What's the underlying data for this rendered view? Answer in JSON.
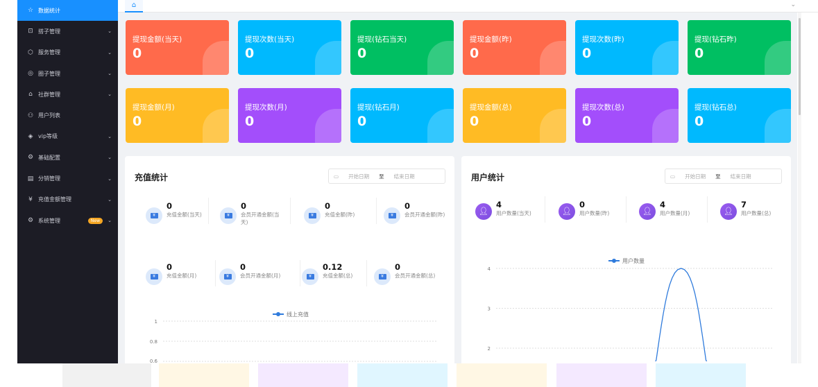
{
  "sidebar": {
    "items": [
      {
        "label": "数据统计",
        "icon": "star-icon",
        "glyph": "☆",
        "active": true
      },
      {
        "label": "搭子管理",
        "icon": "partner-icon",
        "glyph": "⊡",
        "chevron": true
      },
      {
        "label": "服务管理",
        "icon": "cube-icon",
        "glyph": "⬡",
        "chevron": true
      },
      {
        "label": "圈子管理",
        "icon": "palette-icon",
        "glyph": "◎",
        "chevron": true
      },
      {
        "label": "社群管理",
        "icon": "hat-icon",
        "glyph": "⌂",
        "chevron": true
      },
      {
        "label": "用户列表",
        "icon": "users-icon",
        "glyph": "⚇"
      },
      {
        "label": "vip等级",
        "icon": "layers-icon",
        "glyph": "◈",
        "chevron": true
      },
      {
        "label": "基础配置",
        "icon": "gears-icon",
        "glyph": "⚙",
        "chevron": true
      },
      {
        "label": "分销管理",
        "icon": "document-icon",
        "glyph": "▤",
        "chevron": true
      },
      {
        "label": "充值金额管理",
        "icon": "yen-icon",
        "glyph": "¥",
        "chevron": true
      },
      {
        "label": "系统管理",
        "icon": "settings-icon",
        "glyph": "⚙",
        "chevron": true,
        "badge": "New"
      }
    ]
  },
  "topbar": {
    "home_glyph": "⌂",
    "chevron": "⌄"
  },
  "cards_row1": [
    {
      "label": "提现金额(当天)",
      "value": "0",
      "color": "#ff6a4b"
    },
    {
      "label": "提现次数(当天)",
      "value": "0",
      "color": "#00b9fe"
    },
    {
      "label": "提现(钻石当天)",
      "value": "0",
      "color": "#00bf62"
    },
    {
      "label": "提现金额(昨)",
      "value": "0",
      "color": "#ff6a4b"
    },
    {
      "label": "提现次数(昨)",
      "value": "0",
      "color": "#00b9fe"
    },
    {
      "label": "提现(钻石昨)",
      "value": "0",
      "color": "#00bf62"
    }
  ],
  "cards_row2": [
    {
      "label": "提现金额(月)",
      "value": "0",
      "color": "#ffbb24"
    },
    {
      "label": "提现次数(月)",
      "value": "0",
      "color": "#a34efb"
    },
    {
      "label": "提现(钻石月)",
      "value": "0",
      "color": "#00b9fe"
    },
    {
      "label": "提现金额(总)",
      "value": "0",
      "color": "#ffbb24"
    },
    {
      "label": "提现次数(总)",
      "value": "0",
      "color": "#a34efb"
    },
    {
      "label": "提现(钻石总)",
      "value": "0",
      "color": "#00b9fe"
    }
  ],
  "recharge": {
    "title": "充值统计",
    "date_start": "开始日期",
    "date_to": "至",
    "date_end": "结束日期",
    "stats": [
      {
        "value": "0",
        "label": "充值金额(当天)"
      },
      {
        "value": "0",
        "label": "会员开通金额(当天)"
      },
      {
        "value": "0",
        "label": "充值金额(昨)"
      },
      {
        "value": "0",
        "label": "会员开通金额(昨)"
      },
      {
        "value": "0",
        "label": "充值金额(月)"
      },
      {
        "value": "0",
        "label": "会员开通金额(月)"
      },
      {
        "value": "0.12",
        "label": "充值金额(总)"
      },
      {
        "value": "0",
        "label": "会员开通金额(总)"
      }
    ]
  },
  "users": {
    "title": "用户统计",
    "date_start": "开始日期",
    "date_to": "至",
    "date_end": "结束日期",
    "stats": [
      {
        "value": "4",
        "label": "用户数量(当天)"
      },
      {
        "value": "0",
        "label": "用户数量(昨)"
      },
      {
        "value": "4",
        "label": "用户数量(月)"
      },
      {
        "value": "7",
        "label": "用户数量(总)"
      }
    ]
  },
  "chart_data": [
    {
      "type": "line",
      "title": "",
      "legend": [
        "线上充值"
      ],
      "legend_placement": "top",
      "yticks": [
        "1",
        "0.8",
        "0.6"
      ],
      "ylim": [
        0,
        1
      ],
      "series": [
        {
          "name": "线上充值",
          "values": [
            0,
            0,
            0,
            0,
            0,
            0,
            0
          ]
        }
      ],
      "grid": true,
      "color": "#2f7bdc"
    },
    {
      "type": "line",
      "title": "",
      "legend": [
        "用户数量"
      ],
      "legend_placement": "top",
      "yticks": [
        "4",
        "3",
        "2"
      ],
      "ylim": [
        0,
        4
      ],
      "series": [
        {
          "name": "用户数量",
          "values": [
            0,
            0,
            0,
            0,
            4,
            0,
            0
          ]
        }
      ],
      "grid": true,
      "color": "#2f7bdc"
    }
  ]
}
